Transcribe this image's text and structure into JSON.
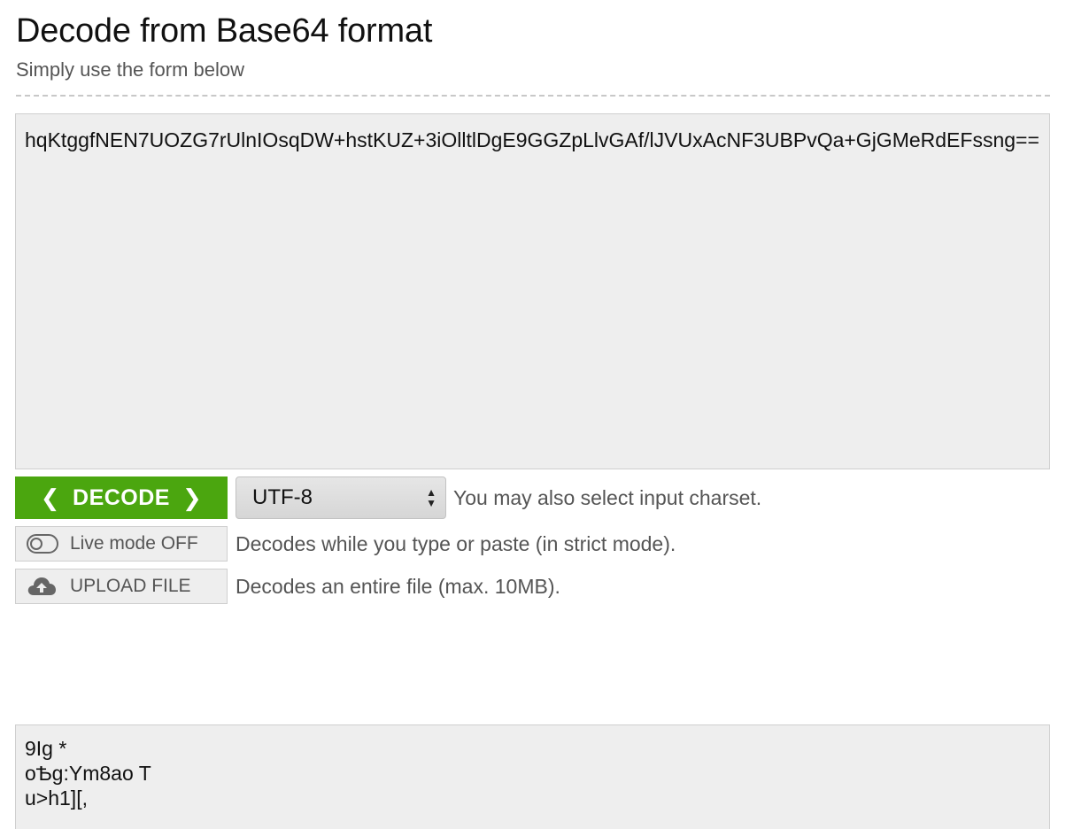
{
  "header": {
    "title": "Decode from Base64 format",
    "subtitle": "Simply use the form below"
  },
  "input": {
    "value": "hqKtggfNEN7UOZG7rUlnIOsqDW+hstKUZ+3iOlltlDgE9GGZpLlvGAf/lJVUxAcNF3UBPvQa+GjGMeRdEFssng=="
  },
  "controls": {
    "decode_label": "DECODE",
    "charset_value": "UTF-8",
    "charset_hint": "You may also select input charset.",
    "live_mode_label": "Live mode OFF",
    "live_mode_hint": "Decodes while you type or paste (in strict mode).",
    "upload_label": "UPLOAD FILE",
    "upload_hint": "Decodes an entire file (max. 10MB)."
  },
  "output": {
    "value": "9Ig *\noѢg:Ym8ao T\nu>h1][,"
  },
  "colors": {
    "accent": "#4ba60f",
    "field_bg": "#eeeeee"
  }
}
